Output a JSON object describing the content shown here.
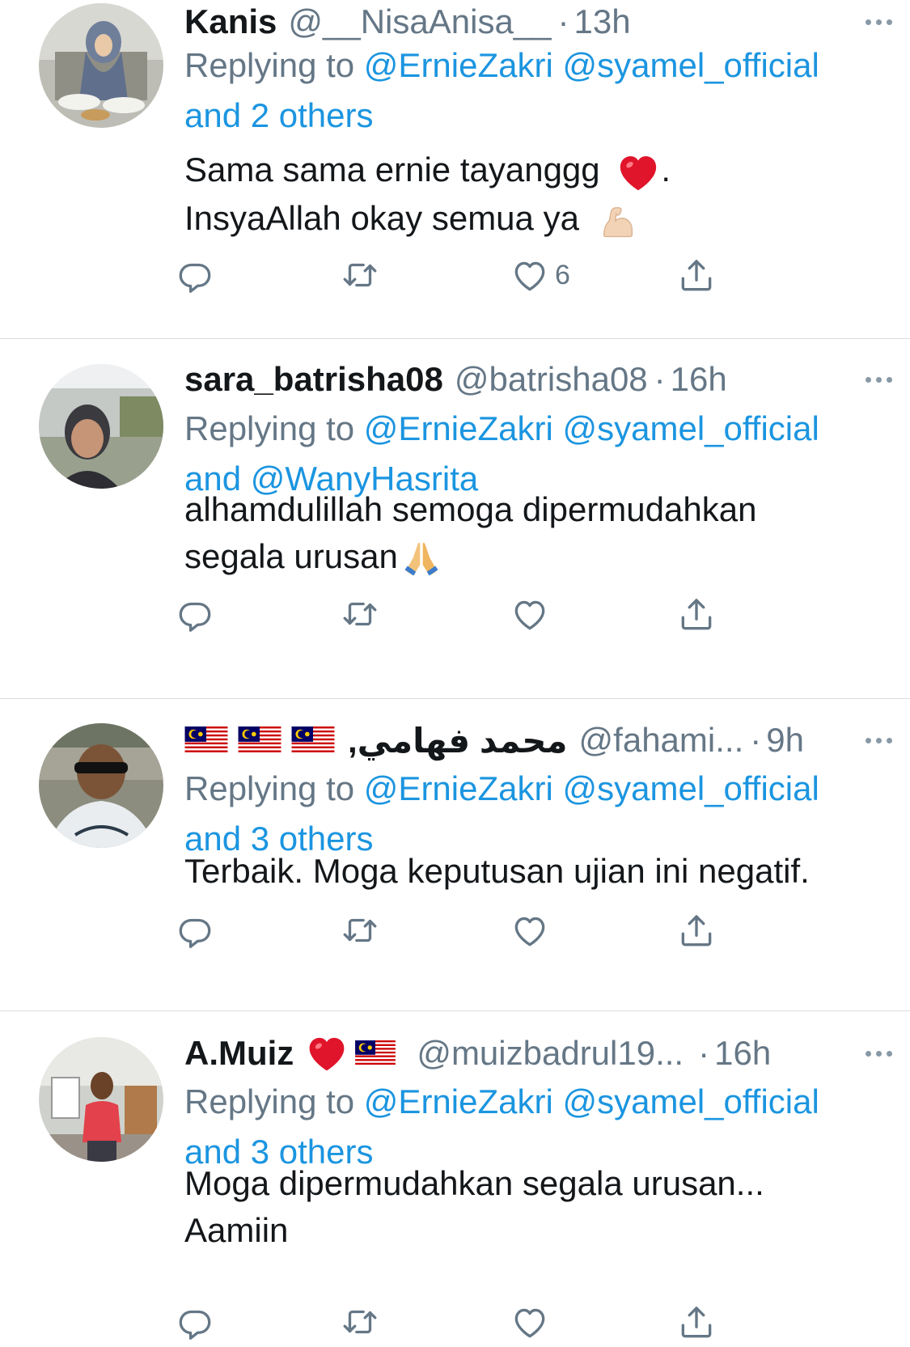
{
  "tweets": [
    {
      "name": "Kanis",
      "handle": "@__NisaAnisa__",
      "time": "13h",
      "reply_prefix": "Replying to",
      "reply_to": [
        "@ErnieZakri",
        "@syamel_official"
      ],
      "reply_suffix": "and 2 others",
      "text_lines": [
        "Sama sama ernie tayanggg",
        "InsyaAllah okay semua ya"
      ],
      "like_count": "6"
    },
    {
      "name": "sara_batrisha08",
      "handle": "@batrisha08",
      "time": "16h",
      "reply_prefix": "Replying to",
      "reply_to": [
        "@ErnieZakri",
        "@syamel_official"
      ],
      "reply_and": "and",
      "reply_suffix": "@WanyHasrita",
      "text_lines": [
        "alhamdulillah semoga dipermudahkan",
        "segala urusan"
      ],
      "like_count": ""
    },
    {
      "name": "محمد فهامي,",
      "handle": "@fahami...",
      "time": "9h",
      "reply_prefix": "Replying to",
      "reply_to": [
        "@ErnieZakri",
        "@syamel_official"
      ],
      "reply_suffix": "and 3 others",
      "text_lines": [
        "Terbaik. Moga keputusan ujian ini negatif."
      ],
      "like_count": ""
    },
    {
      "name": "A.Muiz",
      "handle": "@muizbadrul19...",
      "time": "16h",
      "reply_prefix": "Replying to",
      "reply_to": [
        "@ErnieZakri",
        "@syamel_official"
      ],
      "reply_suffix": "and 3 others",
      "text_lines": [
        "Moga dipermudahkan segala urusan...",
        "Aamiin"
      ],
      "like_count": ""
    }
  ],
  "separator": "·",
  "colors": {
    "text": "#14171a",
    "muted": "#657786",
    "link": "#1b95e0",
    "divider": "#d9dde1",
    "icon": "#8899a6"
  },
  "icons": [
    "reply-icon",
    "retweet-icon",
    "like-icon",
    "share-icon",
    "more-icon",
    "malaysia-flag-icon",
    "red-heart-emoji",
    "flexed-biceps-emoji",
    "folded-hands-emoji"
  ]
}
